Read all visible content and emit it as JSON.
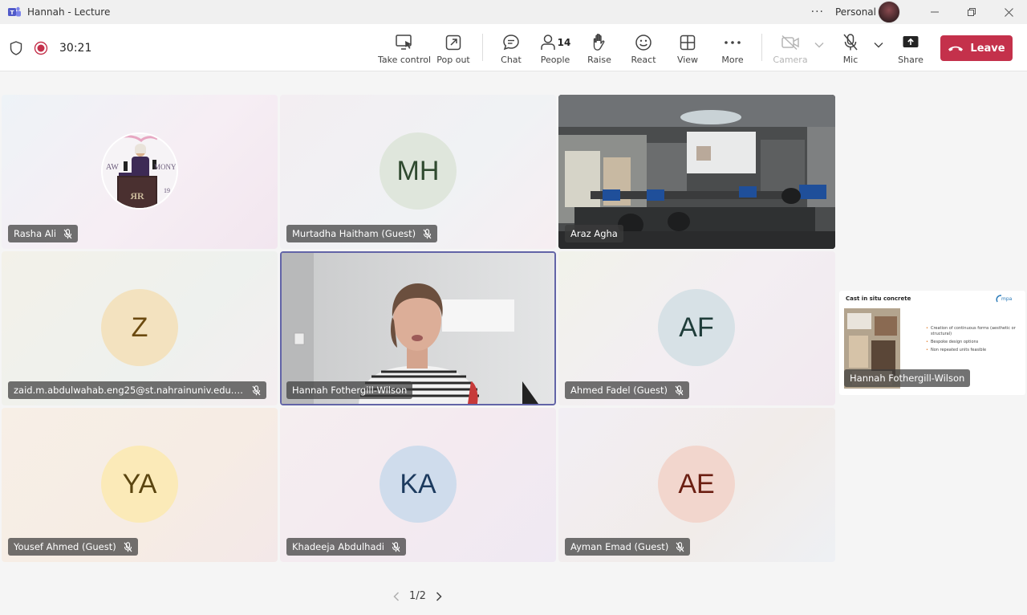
{
  "window": {
    "title": "Hannah - Lecture",
    "account_label": "Personal",
    "more_dots": "···"
  },
  "toolbar": {
    "timer": "30:21",
    "take_control": "Take control",
    "pop_out": "Pop out",
    "chat": "Chat",
    "people": "People",
    "people_count": "14",
    "raise": "Raise",
    "react": "React",
    "view": "View",
    "more": "More",
    "camera": "Camera",
    "mic": "Mic",
    "share": "Share",
    "leave": "Leave"
  },
  "participants": [
    {
      "name": "Rasha Ali",
      "initials": "",
      "muted": true
    },
    {
      "name": "Murtadha Haitham (Guest)",
      "initials": "MH",
      "muted": true
    },
    {
      "name": "Araz Agha",
      "initials": "",
      "muted": false
    },
    {
      "name": "zaid.m.abdulwahab.eng25@st.nahrainuniv.edu.iq (Gu...",
      "initials": "Z",
      "muted": true
    },
    {
      "name": "Hannah Fothergill-Wilson",
      "initials": "",
      "muted": false
    },
    {
      "name": "Ahmed Fadel (Guest)",
      "initials": "AF",
      "muted": true
    },
    {
      "name": "Yousef Ahmed (Guest)",
      "initials": "YA",
      "muted": true
    },
    {
      "name": "Khadeeja Abdulhadi",
      "initials": "KA",
      "muted": true
    },
    {
      "name": "Ayman Emad (Guest)",
      "initials": "AE",
      "muted": true
    }
  ],
  "rasha_poster": {
    "text_left": "AW",
    "text_right": "MONY",
    "text_year": "19",
    "monogram": "ЯR"
  },
  "share_preview": {
    "slide_title": "Cast in situ concrete",
    "bullets": [
      "Creation of continuous forms (aesthetic or structural)",
      "Bespoke design options",
      "Non repeated units feasible"
    ],
    "presenter": "Hannah Fothergill-Wilson"
  },
  "pager": {
    "label": "1/2"
  },
  "colors": {
    "leave": "#c4314b",
    "active_border": "#6264a7",
    "avatar_MH": "#dfe6dc",
    "avatar_Z": "#f3e2bf",
    "avatar_AF": "#d7e1e6",
    "avatar_YA": "#fbeab8",
    "avatar_KA": "#cfdcec",
    "avatar_AE": "#f2d6cd"
  }
}
